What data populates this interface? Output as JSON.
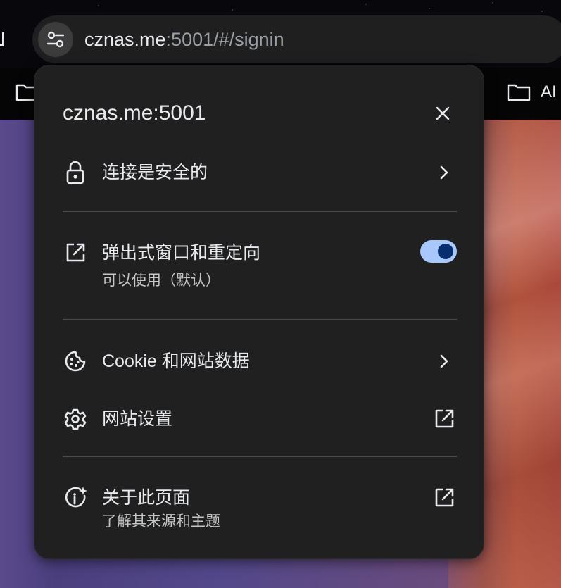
{
  "omnibox": {
    "url_host": "cznas.me",
    "url_rest": ":5001/#/signin"
  },
  "bookmarks_bar": {
    "right_folder_label": "AI"
  },
  "popup": {
    "title": "cznas.me:5001",
    "connection": {
      "label": "连接是安全的"
    },
    "popups": {
      "label": "弹出式窗口和重定向",
      "sublabel": "可以使用（默认）",
      "enabled": true
    },
    "cookies": {
      "label": "Cookie 和网站数据"
    },
    "site_settings": {
      "label": "网站设置"
    },
    "about_page": {
      "label": "关于此页面",
      "sublabel": "了解其来源和主题"
    }
  },
  "colors": {
    "popup_bg": "#202020",
    "text_primary": "#e8eaed",
    "toggle_track": "#a8c7fa",
    "toggle_knob": "#062e6f"
  },
  "icons": [
    "tune-icon",
    "home-icon",
    "folder-icon",
    "close-icon",
    "lock-icon",
    "chevron-right-icon",
    "open-in-new-icon",
    "cookie-icon",
    "gear-icon",
    "info-sparkle-icon"
  ]
}
